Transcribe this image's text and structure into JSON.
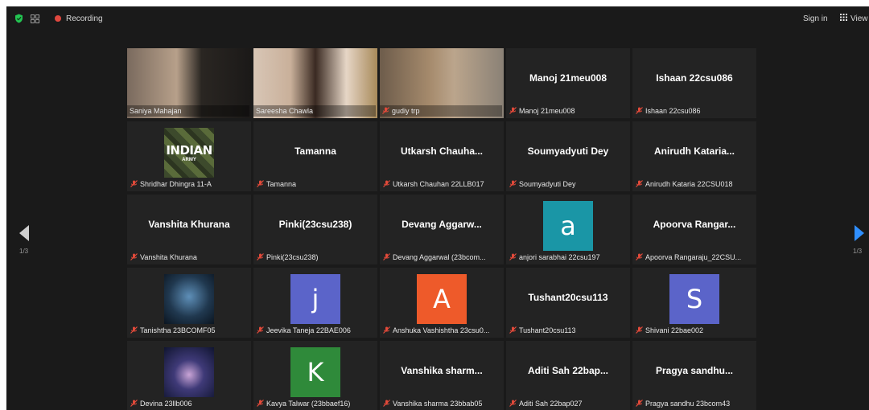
{
  "topbar": {
    "recording_label": "Recording",
    "sign_in_label": "Sign in",
    "view_label": "View"
  },
  "pagination": {
    "left": "1/3",
    "right": "1/3"
  },
  "icons": {
    "shield": "shield-check-icon",
    "grid": "grid-icon",
    "recording": "record-dot-icon",
    "view": "grid-view-icon",
    "nav_left": "arrow-left-icon",
    "nav_right": "arrow-right-icon",
    "mic_muted": "mic-muted-icon"
  },
  "colors": {
    "active_border": "#c6d36a",
    "nav_right": "#2f8fff",
    "nav_left": "#cfcfcf",
    "recording_dot": "#e0483f"
  },
  "participants": [
    {
      "label": "Saniya Mahajan",
      "type": "video",
      "muted": false
    },
    {
      "label": "Sareesha Chawla",
      "type": "video",
      "muted": false,
      "active": true
    },
    {
      "label": "gudiy trp",
      "type": "video",
      "muted": true
    },
    {
      "name": "Manoj 21meu008",
      "label": "Manoj 21meu008",
      "type": "name",
      "muted": true
    },
    {
      "name": "Ishaan 22csu086",
      "label": "Ishaan 22csu086",
      "type": "name",
      "muted": true
    },
    {
      "label": "Shridhar Dhingra 11-A",
      "type": "image",
      "image": "indian-army-logo",
      "logo_text": "INDIAN",
      "logo_sub": "ARMY",
      "muted": true
    },
    {
      "name": "Tamanna",
      "label": "Tamanna",
      "type": "name",
      "muted": true
    },
    {
      "name": "Utkarsh Chauha...",
      "label": "Utkarsh Chauhan 22LLB017",
      "type": "name",
      "muted": true
    },
    {
      "name": "Soumyadyuti Dey",
      "label": "Soumyadyuti Dey",
      "type": "name",
      "muted": true
    },
    {
      "name": "Anirudh Kataria...",
      "label": "Anirudh Kataria 22CSU018",
      "type": "name",
      "muted": true
    },
    {
      "name": "Vanshita Khurana",
      "label": "Vanshita Khurana",
      "type": "name",
      "muted": true
    },
    {
      "name": "Pinki(23csu238)",
      "label": "Pinki(23csu238)",
      "type": "name",
      "muted": true
    },
    {
      "name": "Devang Aggarw...",
      "label": "Devang Aggarwal (23bcom...",
      "type": "name",
      "muted": true
    },
    {
      "letter": "a",
      "avatar_color": "#1a96a6",
      "label": "anjori sarabhai 22csu197",
      "type": "letter",
      "muted": true
    },
    {
      "name": "Apoorva Rangar...",
      "label": "Apoorva Rangaraju_22CSU...",
      "type": "name",
      "muted": true
    },
    {
      "label": "Tanishtha 23BCOMF05",
      "type": "image",
      "image": "shiva-silhouette",
      "muted": true
    },
    {
      "letter": "j",
      "avatar_color": "#5b64c9",
      "label": "Jeevika Taneja 22BAE006",
      "type": "letter",
      "muted": true
    },
    {
      "letter": "A",
      "avatar_color": "#ee5a2a",
      "label": "Anshuka Vashishtha 23csu0...",
      "type": "letter",
      "muted": true
    },
    {
      "name": "Tushant20csu113",
      "label": "Tushant20csu113",
      "type": "name",
      "muted": true
    },
    {
      "letter": "S",
      "avatar_color": "#5b64c9",
      "label": "Shivani 22bae002",
      "type": "letter",
      "muted": true
    },
    {
      "label": "Devina 23llb006",
      "type": "image",
      "image": "galaxy",
      "muted": true
    },
    {
      "letter": "K",
      "avatar_color": "#2f8a3a",
      "label": "Kavya Talwar (23bbaef16)",
      "type": "letter",
      "muted": true
    },
    {
      "name": "Vanshika sharm...",
      "label": "Vanshika sharma 23bbab05",
      "type": "name",
      "muted": true
    },
    {
      "name": "Aditi Sah 22bap...",
      "label": "Aditi Sah 22bap027",
      "type": "name",
      "muted": true
    },
    {
      "name": "Pragya sandhu...",
      "label": "Pragya sandhu 23bcom43",
      "type": "name",
      "muted": true
    }
  ]
}
